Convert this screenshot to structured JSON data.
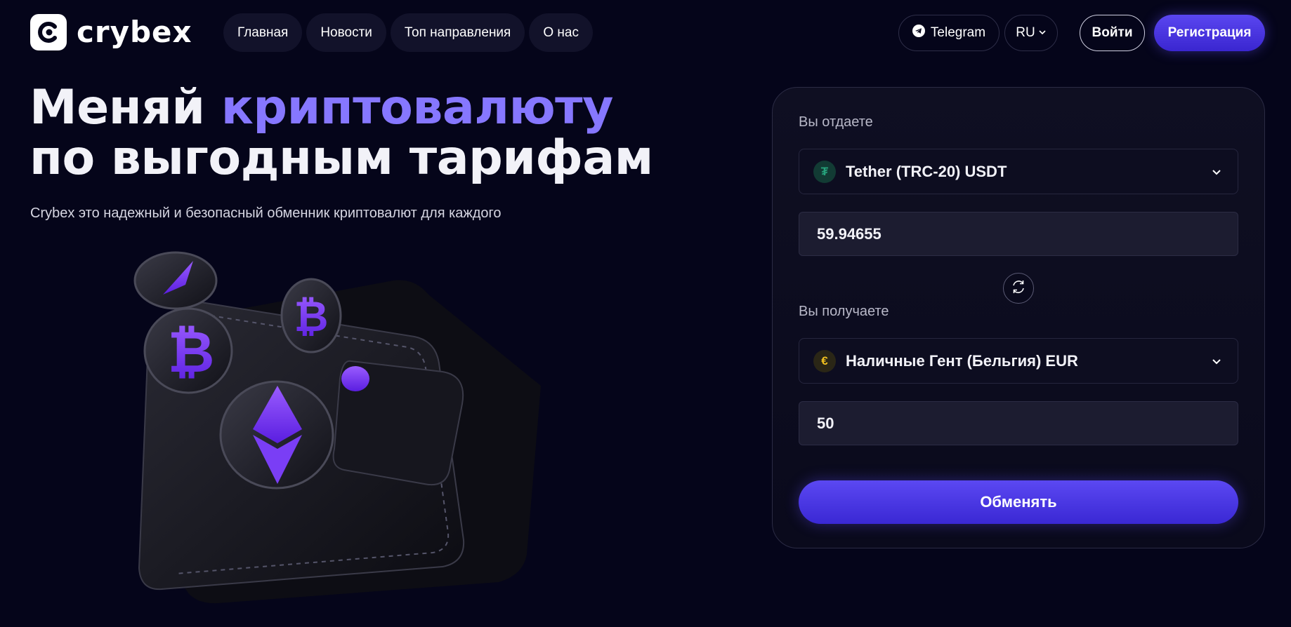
{
  "brand": {
    "name": "crybex"
  },
  "nav": {
    "items": [
      {
        "label": "Главная"
      },
      {
        "label": "Новости"
      },
      {
        "label": "Топ направления"
      },
      {
        "label": "О нас"
      }
    ]
  },
  "header_actions": {
    "telegram_label": "Telegram",
    "language": "RU",
    "login_label": "Войти",
    "register_label": "Регистрация"
  },
  "hero": {
    "title_part1": "Меняй ",
    "title_accent": "криптовалюту",
    "title_part2": " по выгодным тарифам",
    "subtitle": "Crybex это надежный и безопасный обменник криптовалют для каждого"
  },
  "exchange": {
    "give_label": "Вы отдаете",
    "give_currency": "Tether (TRC-20) USDT",
    "give_icon": "usdt-coin-icon",
    "give_amount": "59.94655",
    "receive_label": "Вы получаете",
    "receive_currency": "Наличные Гент (Бельгия) EUR",
    "receive_icon": "euro-coin-icon",
    "receive_amount": "50",
    "submit_label": "Обменять"
  },
  "colors": {
    "background": "#05051a",
    "accent": "#8677ff",
    "button": "#4a36e6"
  }
}
